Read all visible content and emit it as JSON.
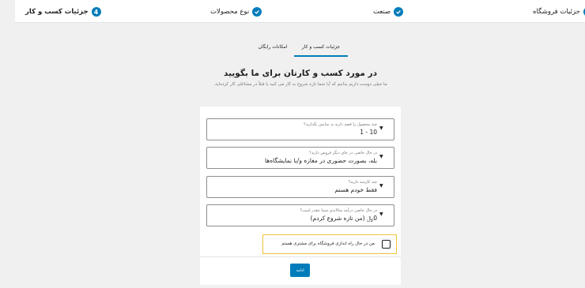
{
  "stepper": {
    "steps": [
      {
        "label": "جزئیات فروشگاه",
        "status": "complete"
      },
      {
        "label": "صنعت",
        "status": "complete"
      },
      {
        "label": "نوع محصولات",
        "status": "complete"
      },
      {
        "label": "جزئیات کسب و کار",
        "status": "active",
        "number": "4"
      }
    ]
  },
  "tabs": [
    {
      "label": "جزئیات کسب و کار",
      "selected": true
    },
    {
      "label": "امکانات رایگان",
      "selected": false
    }
  ],
  "heading": "در مورد کسب و کارتان برای ما بگویید",
  "subtext": "ما خیلی دوست داریم بدانیم که آیا شما تازه شروع به کار می کنید یا قبلاً در مشاغلی کار کرده‌اید.",
  "fields": [
    {
      "label": "چند محصول را قصد دارید به نمایش بگذارید؟",
      "value": "1 - 10"
    },
    {
      "label": "در حال حاضر، در جای دیگر فروش دارید؟",
      "value": "بله، بصورت حضوری در مغازه و/یا نمایشگاه‌ها"
    },
    {
      "label": "چند کارمند دارید؟",
      "value": "فقط خودم هستم"
    },
    {
      "label": "در حال حاضر، درآمد سالانه‌ی شما چقدر است؟",
      "value": "0﷼ (من تازه شروع کردم)"
    }
  ],
  "checkbox": {
    "label": "من در حال راه اندازی فروشگاه برای مشتری هستم",
    "checked": false
  },
  "continue_label": "ادامه",
  "colors": {
    "accent": "#007cba",
    "highlight": "#f0c33c",
    "background": "#f0f0f1"
  }
}
